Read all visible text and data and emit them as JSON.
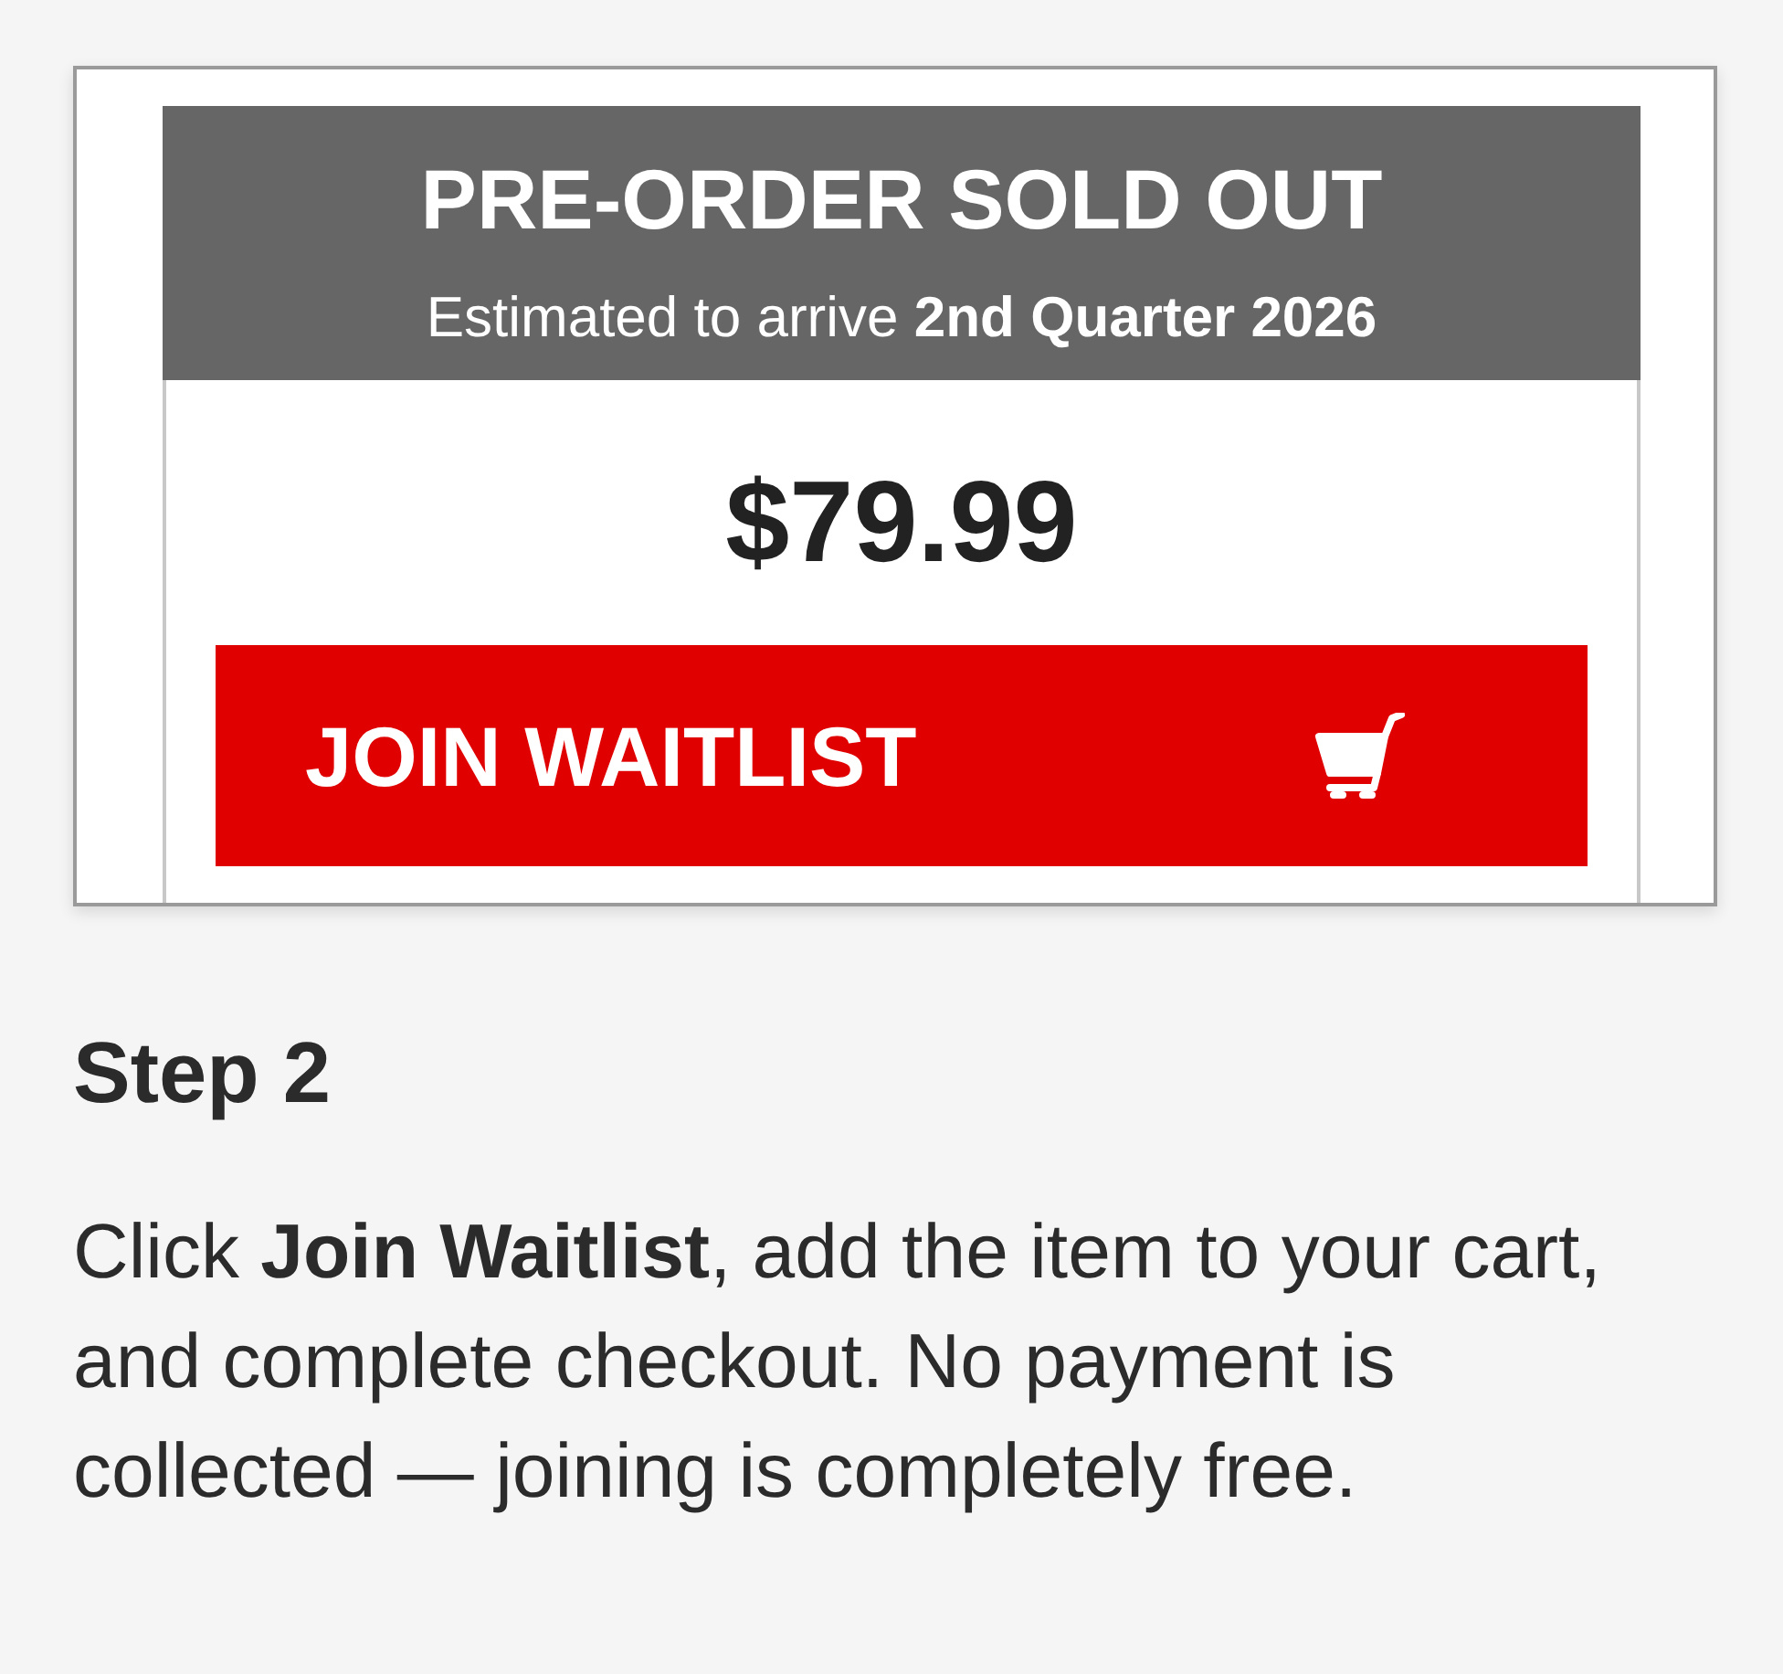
{
  "product_screenshot": {
    "status_title": "PRE-ORDER SOLD OUT",
    "arrival_note": "Estimated to arrive **2nd Quarter 2026**",
    "price": "$79.99",
    "button": {
      "label": "JOIN WAITLIST"
    }
  },
  "step": {
    "heading": "Step 2",
    "text": "Click **Join Waitlist**, add the item to your cart, and complete checkout. No payment is collected — joining is completely free."
  }
}
